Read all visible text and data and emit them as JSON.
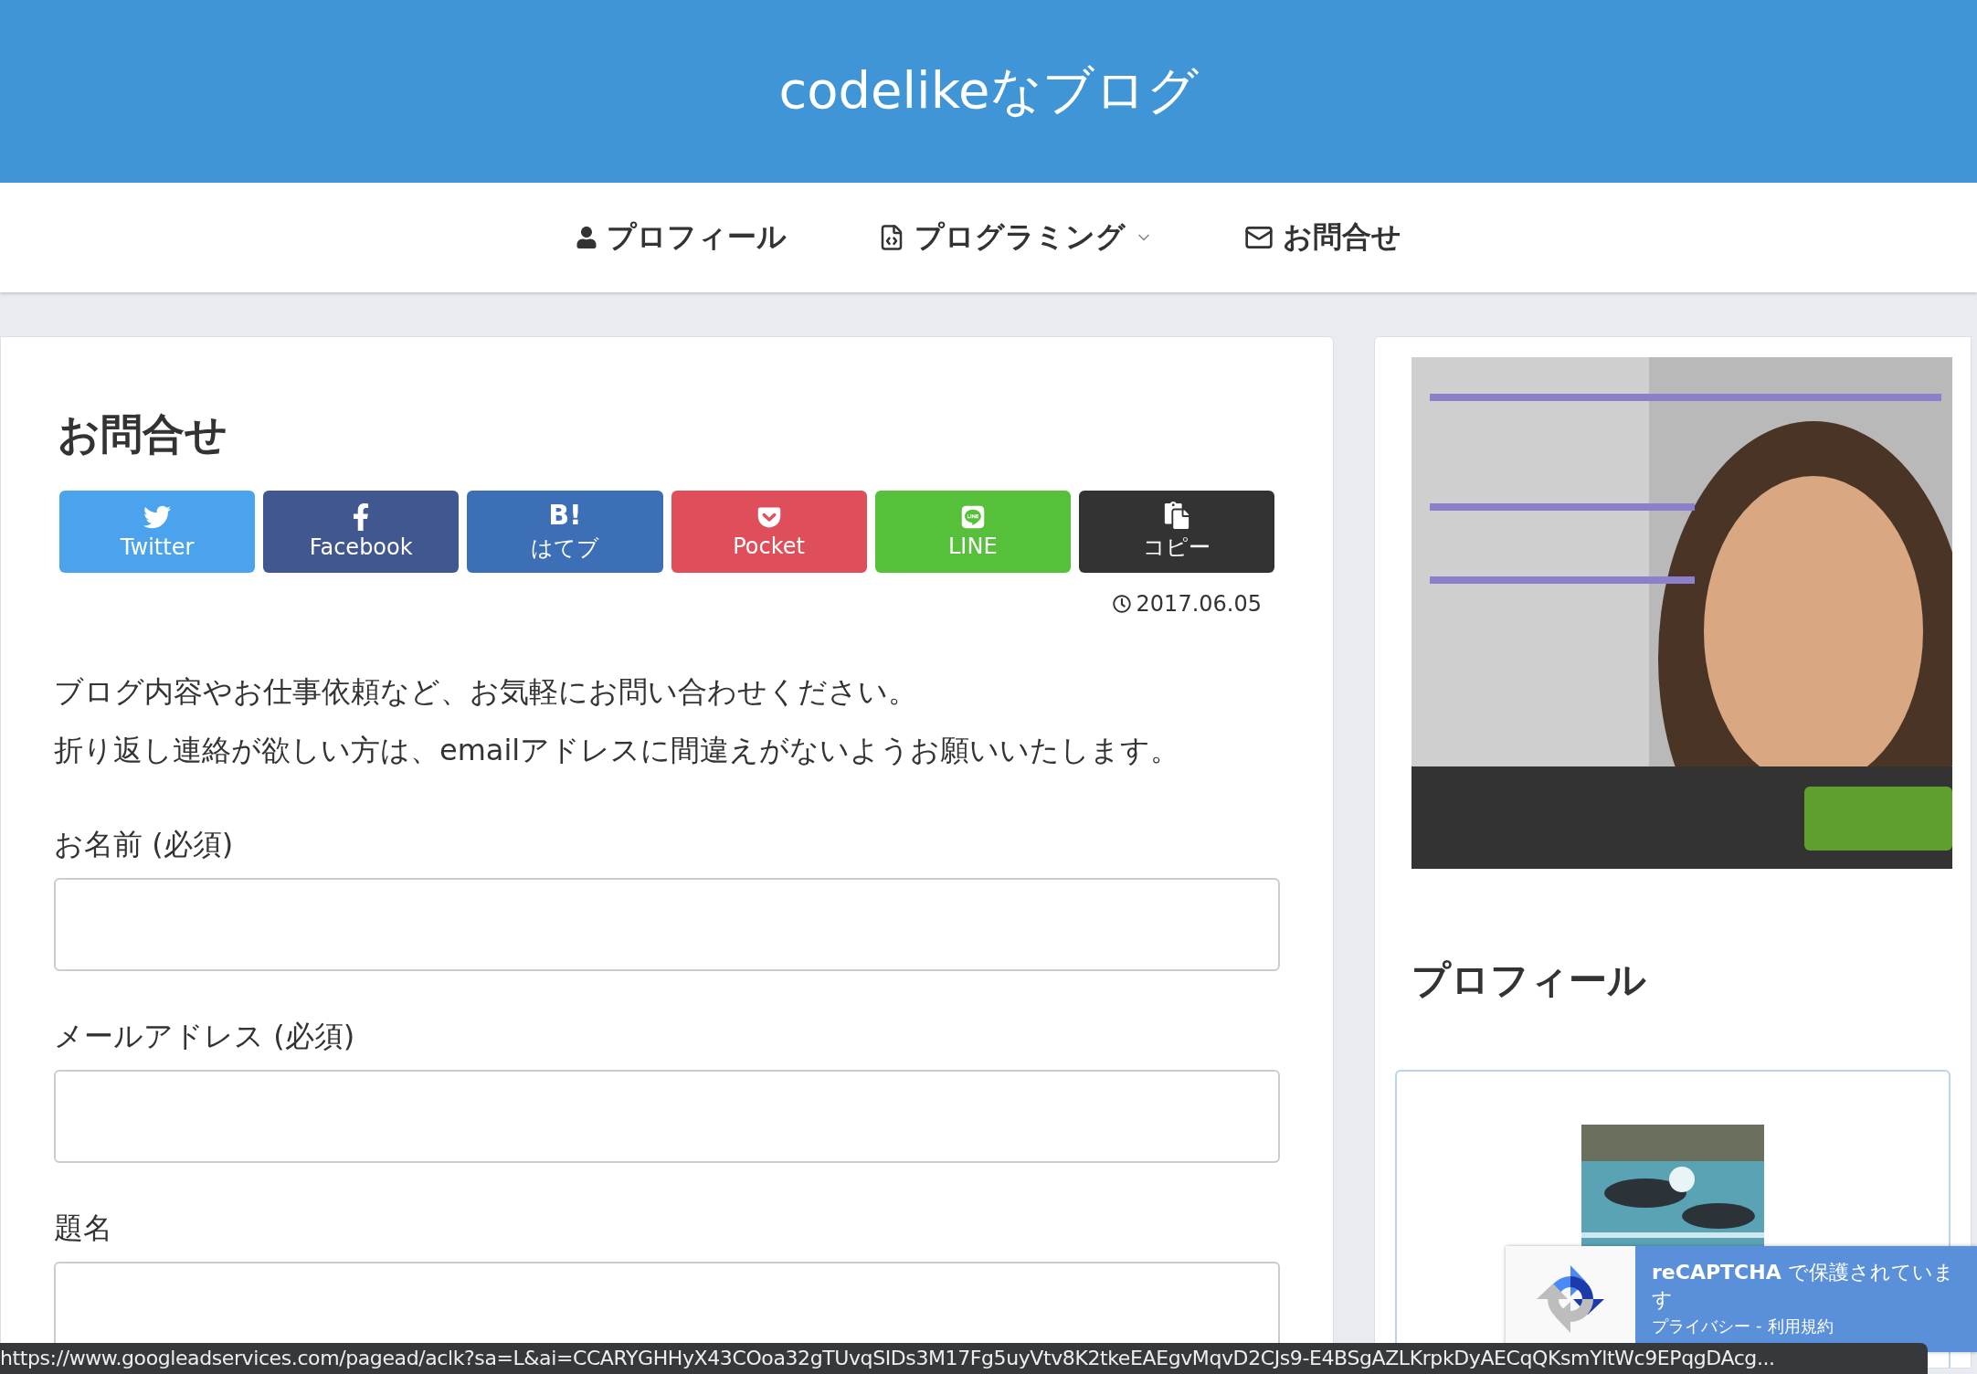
{
  "header": {
    "title": "codelikeなブログ"
  },
  "nav": [
    {
      "label": "プロフィール",
      "kind": "user",
      "dropdown": false
    },
    {
      "label": "プログラミング",
      "kind": "code",
      "dropdown": true
    },
    {
      "label": "お問合せ",
      "kind": "mail",
      "dropdown": false
    }
  ],
  "article": {
    "title": "お問合せ",
    "share_buttons": [
      {
        "label": "Twitter",
        "kind": "twitter",
        "color": "#4aa3ec"
      },
      {
        "label": "Facebook",
        "kind": "facebook",
        "color": "#41578f"
      },
      {
        "label": "はてブ",
        "kind": "hatena",
        "glyph": "B!",
        "color": "#3c6fb6"
      },
      {
        "label": "Pocket",
        "kind": "pocket",
        "color": "#de4e5b"
      },
      {
        "label": "LINE",
        "kind": "line",
        "color": "#57c03a"
      },
      {
        "label": "コピー",
        "kind": "copy",
        "color": "#333333"
      }
    ],
    "date": "2017.06.05",
    "paragraphs": [
      "ブログ内容やお仕事依頼など、お気軽にお問い合わせください。",
      "折り返し連絡が欲しい方は、emailアドレスに間違えがないようお願いいたします。"
    ],
    "fields": [
      {
        "label": "お名前 (必須)"
      },
      {
        "label": "メールアドレス (必須)"
      },
      {
        "label": "題名"
      }
    ]
  },
  "sidebar": {
    "profile": {
      "title": "プロフィール"
    }
  },
  "recaptcha": {
    "title": "**reCAPTCHA** で保護されています",
    "privacy": "プライバシー",
    "separator": "-",
    "terms": "利用規約"
  },
  "status_bar": {
    "url": "https://www.googleadservices.com/pagead/aclk?sa=L&ai=CCARYGHHyX43COoa32gTUvqSIDs3M17Fg5uyVtv8K2tkeEAEgvMqvD2CJs9-E4BSgAZLKrpkDyAECqQKsmYltWc9EPqgDAcg..."
  }
}
